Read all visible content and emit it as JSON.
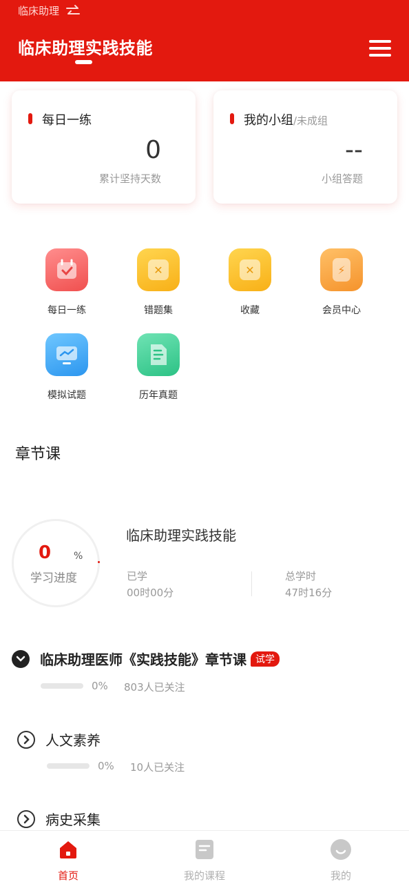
{
  "header": {
    "switch_label": "临床助理",
    "title": "临床助理实践技能"
  },
  "cards": {
    "daily": {
      "title": "每日一练",
      "value": "0",
      "caption": "累计坚持天数"
    },
    "group": {
      "title": "我的小组",
      "subtitle": "/未成组",
      "value": "--",
      "caption": "小组答题"
    }
  },
  "quick_actions": [
    {
      "label": "每日一练",
      "icon": "calendar-check-icon",
      "color": "#f56a6a"
    },
    {
      "label": "错题集",
      "icon": "wrong-questions-icon",
      "color": "#fbbd2f"
    },
    {
      "label": "收藏",
      "icon": "favorite-icon",
      "color": "#fbbd2f"
    },
    {
      "label": "会员中心",
      "icon": "lightning-icon",
      "color": "#f9a43c"
    },
    {
      "label": "模拟试题",
      "icon": "monitor-chart-icon",
      "color": "#3fa9f5"
    },
    {
      "label": "历年真题",
      "icon": "document-icon",
      "color": "#3ecf8e"
    }
  ],
  "section": {
    "title": "章节课"
  },
  "progress": {
    "value": "0",
    "unit": "%",
    "label": "学习进度",
    "course_name": "临床助理实践技能",
    "learned_label": "已学",
    "learned_value": "00时00分",
    "total_label": "总学时",
    "total_value": "47时16分"
  },
  "chapters": [
    {
      "title": "临床助理医师《实践技能》章节课",
      "badge": "试学",
      "percent_text": "0%",
      "followers": "803人已关注",
      "progress": 0
    },
    {
      "title": "人文素养",
      "percent_text": "0%",
      "followers": "10人已关注",
      "progress": 0
    },
    {
      "title": "病史采集"
    }
  ],
  "tabbar": {
    "home": "首页",
    "courses": "我的课程",
    "mine": "我的"
  },
  "colors": {
    "accent": "#e3190f",
    "muted": "#999999"
  }
}
